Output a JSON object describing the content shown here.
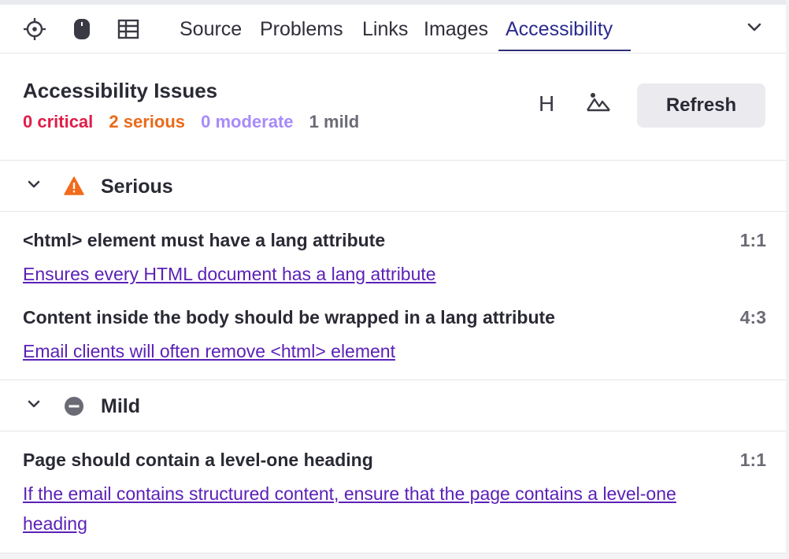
{
  "toolbar": {
    "icons": [
      "crosshair-icon",
      "mouse-icon",
      "table-icon"
    ]
  },
  "tabs": [
    {
      "label": "Source",
      "active": false
    },
    {
      "label": "Problems",
      "active": false
    },
    {
      "label": "Links",
      "active": false
    },
    {
      "label": "Images",
      "active": false
    },
    {
      "label": "Accessibility",
      "active": true
    }
  ],
  "header": {
    "title": "Accessibility Issues",
    "counts": {
      "critical": "0 critical",
      "serious": "2 serious",
      "moderate": "0 moderate",
      "mild": "1 mild"
    },
    "heading_toggle": "H",
    "refresh_label": "Refresh"
  },
  "groups": {
    "serious": {
      "label": "Serious",
      "issues": [
        {
          "text": "<html> element must have a lang attribute",
          "location": "1:1",
          "link": "Ensures every HTML document has a lang attribute"
        },
        {
          "text": "Content inside the body should be wrapped in a lang attribute",
          "location": "4:3",
          "link": "Email clients will often remove <html> element"
        }
      ]
    },
    "mild": {
      "label": "Mild",
      "issues": [
        {
          "text": "Page should contain a level-one heading",
          "location": "1:1",
          "link": "If the email contains structured content, ensure that the page contains a level-one heading"
        }
      ]
    }
  },
  "colors": {
    "critical": "#e11d48",
    "serious": "#ea6a1a",
    "moderate": "#a78bfa",
    "mild": "#6b6b76",
    "link": "#5b21b6",
    "active_tab": "#2a2a8e"
  }
}
